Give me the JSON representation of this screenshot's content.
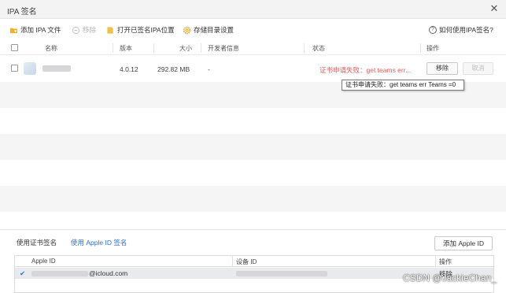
{
  "window": {
    "title": "IPA 签名",
    "close_glyph": "✕"
  },
  "toolbar": {
    "add_ipa": "添加 IPA 文件",
    "remove": "移除",
    "open_signed_location": "打开已签名IPA位置",
    "storage_settings": "存储目录设置",
    "help": "如何使用IPA签名?"
  },
  "table": {
    "columns": {
      "name": "名称",
      "version": "版本",
      "size": "大小",
      "developer": "开发者信息",
      "status": "状态",
      "actions": "操作"
    },
    "rows": [
      {
        "version": "4.0.12",
        "size": "292.82 MB",
        "developer": "-",
        "status": "证书申请失败：get teams err...",
        "remove_label": "移除",
        "cancel_label": "取消"
      }
    ]
  },
  "tooltip": {
    "text": "证书申请失败：get teams err Teams =0"
  },
  "bottom": {
    "tab_cert": "使用证书签名",
    "tab_apple_id": "使用 Apple ID 签名",
    "add_apple_id": "添加 Apple ID",
    "columns": {
      "apple_id": "Apple ID",
      "device_id": "设备 ID",
      "actions": "操作"
    },
    "rows": [
      {
        "check": "✔",
        "email_suffix": "@icloud.com",
        "action": "移除"
      }
    ]
  },
  "watermark": "CSDN @JackieChan_",
  "colors": {
    "error": "#e35a5a",
    "link": "#2b6fd6",
    "folder": "#f0b429",
    "stripe": "#f5f5f6"
  },
  "icons": [
    "folder-add-icon",
    "remove-circle-icon",
    "folder-open-icon",
    "gear-icon",
    "help-icon",
    "close-icon",
    "check-icon"
  ]
}
